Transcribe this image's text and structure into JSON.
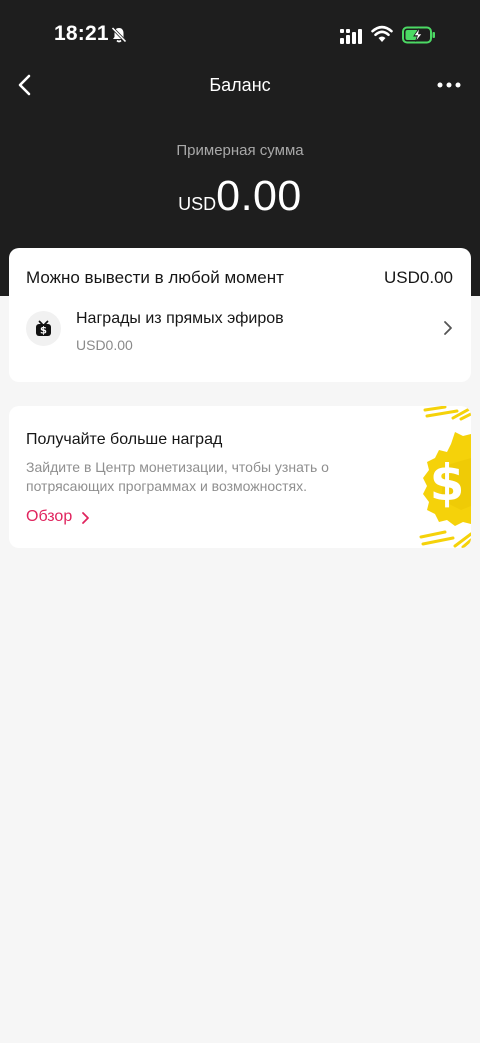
{
  "status_bar": {
    "time": "18:21"
  },
  "nav": {
    "title": "Баланс"
  },
  "summary": {
    "label": "Примерная сумма",
    "currency": "USD",
    "amount": "0.00"
  },
  "withdraw_card": {
    "title": "Можно вывести в любой момент",
    "value": "USD0.00",
    "item": {
      "title": "Награды из прямых эфиров",
      "value": "USD0.00"
    }
  },
  "promo_card": {
    "title": "Получайте больше наград",
    "description": "Зайдите в Центр монетизации, чтобы узнать о потрясающих программах и возможностях.",
    "link": "Обзор",
    "accent_color": "#e0245e",
    "art_color": "#f5d20a"
  }
}
